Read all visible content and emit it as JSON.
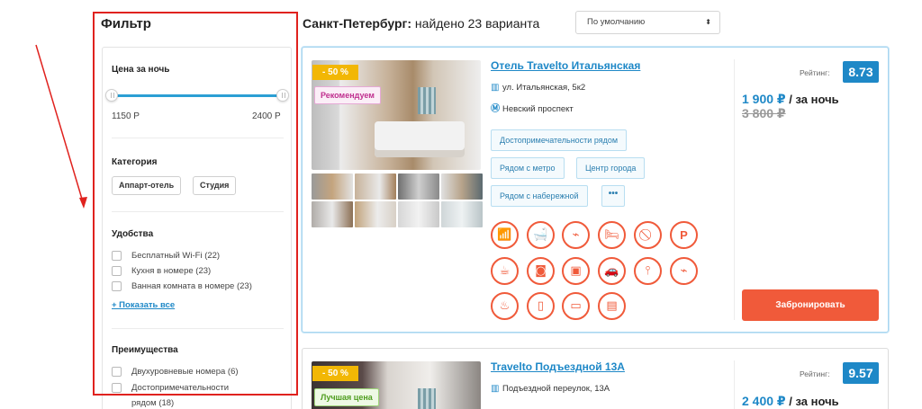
{
  "filter": {
    "title": "Фильтр",
    "price": {
      "title": "Цена за ночь",
      "min_label": "1150 Р",
      "max_label": "2400 Р"
    },
    "category": {
      "title": "Категория",
      "options": [
        "Аппарт-отель",
        "Студия"
      ]
    },
    "amenities": {
      "title": "Удобства",
      "items": [
        "Бесплатный Wi-Fi (22)",
        "Кухня в номере (23)",
        "Ванная комната в номере (23)"
      ],
      "show_all": "+ Показать все"
    },
    "advantages": {
      "title": "Преимущества",
      "items": [
        "Двухуровневые номера (6)",
        "Достопримечательности",
        "рядом (18)"
      ]
    }
  },
  "results": {
    "city": "Санкт-Петербург:",
    "found": "найдено 23 варианта",
    "sort": {
      "selected": "По умолчанию",
      "arrows": "⬍"
    }
  },
  "hotels": [
    {
      "name": "Отель Travelto Итальянская",
      "address": "ул. Итальянская, 5к2",
      "metro": "Невский проспект",
      "discount": "- 50 %",
      "tag": "Рекомендуем",
      "chips": [
        "Достопримечательности рядом",
        "Рядом с метро",
        "Центр города",
        "Рядом с набережной"
      ],
      "more": "•••",
      "rating_label": "Рейтинг:",
      "rating": "8.73",
      "price": "1 900 ₽",
      "per_night": " / за ночь",
      "old_price": "3 800 ₽",
      "book": "Забронировать"
    },
    {
      "name": "Travelto Подъездной 13А",
      "address": "Подъездной переулок, 13А",
      "discount": "- 50 %",
      "tag": "Лучшая цена",
      "rating_label": "Рейтинг:",
      "rating": "9.57",
      "price": "2 400 ₽",
      "per_night": " / за ночь"
    }
  ],
  "icons": {
    "building": "building-icon",
    "metro": "metro-icon",
    "amenities": [
      "wifi-icon",
      "bathtub-icon",
      "hairdryer-icon",
      "bed-icon",
      "no-smoking-icon",
      "parking-icon",
      "coffee-icon",
      "washing-machine-icon",
      "tv-icon",
      "car-icon",
      "broom-icon",
      "hairdryer-2-icon",
      "chef-icon",
      "fridge-icon",
      "microwave-icon",
      "kettle-icon"
    ]
  },
  "colors": {
    "accent_blue": "#1e88c7",
    "accent_orange": "#f05a3a",
    "highlight_red": "#e0221e",
    "discount_yellow": "#f2b705"
  }
}
